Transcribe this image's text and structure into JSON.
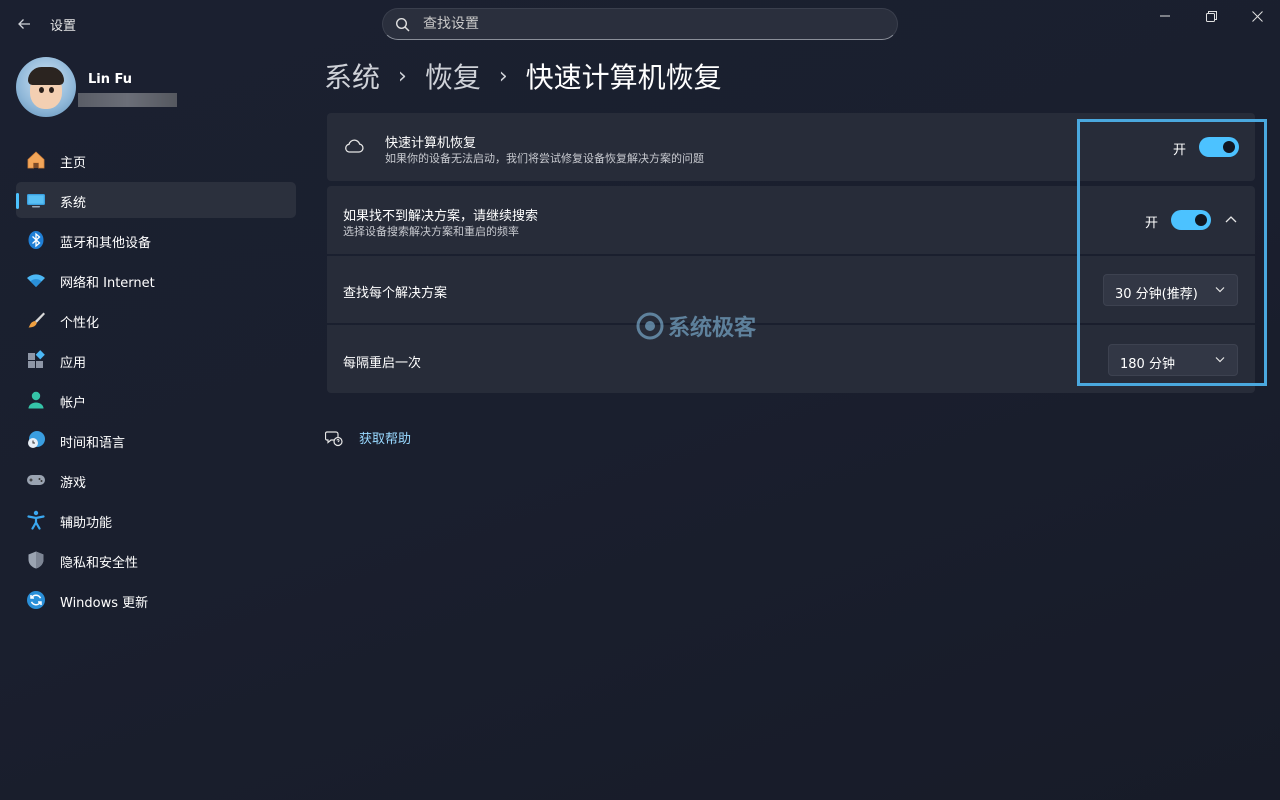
{
  "window": {
    "title": "设置",
    "back_icon": "back-arrow-icon",
    "controls": [
      "minimize-icon",
      "restore-icon",
      "close-icon"
    ]
  },
  "search": {
    "placeholder": "查找设置",
    "value": ""
  },
  "profile": {
    "name": "Lin Fu"
  },
  "sidebar": {
    "items": [
      {
        "label": "主页",
        "icon": "home-icon"
      },
      {
        "label": "系统",
        "icon": "system-icon",
        "active": true
      },
      {
        "label": "蓝牙和其他设备",
        "icon": "bluetooth-icon"
      },
      {
        "label": "网络和 Internet",
        "icon": "wifi-icon"
      },
      {
        "label": "个性化",
        "icon": "brush-icon"
      },
      {
        "label": "应用",
        "icon": "apps-icon"
      },
      {
        "label": "帐户",
        "icon": "account-icon"
      },
      {
        "label": "时间和语言",
        "icon": "globe-clock-icon"
      },
      {
        "label": "游戏",
        "icon": "gamepad-icon"
      },
      {
        "label": "辅助功能",
        "icon": "accessibility-icon"
      },
      {
        "label": "隐私和安全性",
        "icon": "shield-icon"
      },
      {
        "label": "Windows 更新",
        "icon": "update-icon"
      }
    ]
  },
  "breadcrumb": [
    "系统",
    "恢复",
    "快速计算机恢复"
  ],
  "settings": {
    "quick_recovery": {
      "title": "快速计算机恢复",
      "description": "如果你的设备无法启动，我们将尝试修复设备恢复解决方案的问题",
      "toggle_label": "开",
      "enabled": true,
      "icon": "cloud-icon"
    },
    "continue_search": {
      "title": "如果找不到解决方案，请继续搜索",
      "description": "选择设备搜索解决方案和重启的频率",
      "toggle_label": "开",
      "enabled": true,
      "expanded": true
    },
    "find_each_solution": {
      "label": "查找每个解决方案",
      "selected": "30 分钟(推荐)"
    },
    "restart_every": {
      "label": "每隔重启一次",
      "selected": "180 分钟"
    }
  },
  "watermark": {
    "text": "系统极客"
  },
  "help": {
    "label": "获取帮助",
    "icon": "help-chat-icon"
  },
  "colors": {
    "accent": "#4cc2ff",
    "highlight_box": "#4aa8de",
    "card": "#272c39",
    "background": "#1b2030"
  }
}
